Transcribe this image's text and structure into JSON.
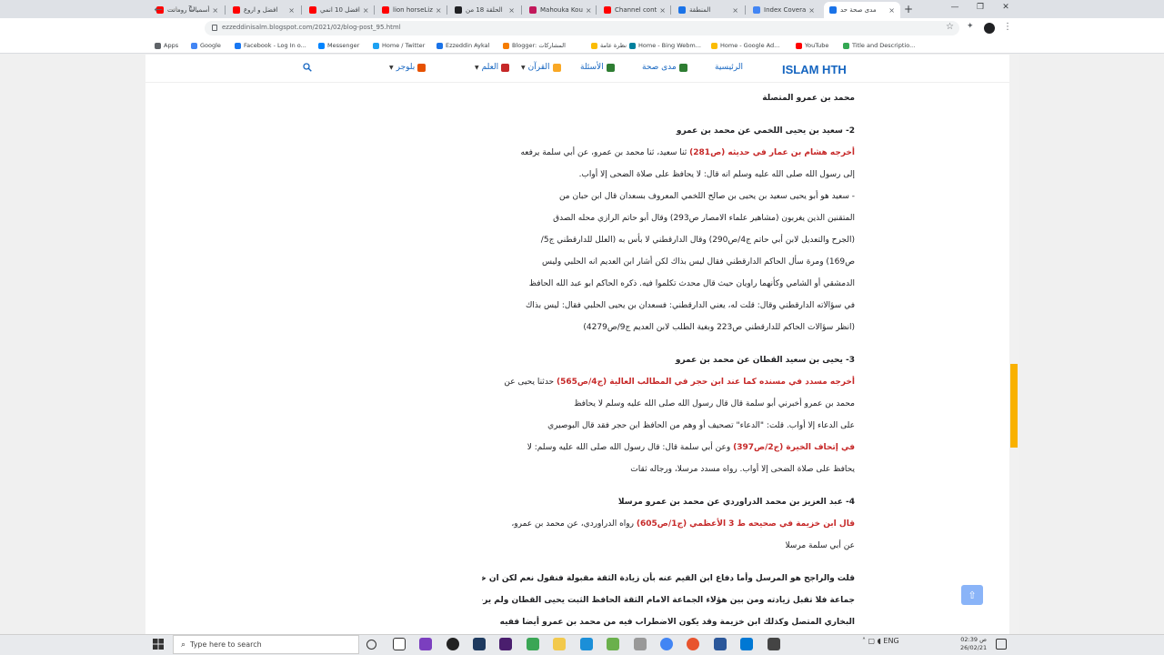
{
  "browser": {
    "tabs": [
      {
        "label": "أسميات رومانت",
        "color": "#ff0000"
      },
      {
        "label": "افضل و اروع",
        "color": "#ff0000"
      },
      {
        "label": "افضل 10 انمي",
        "color": "#ff0000"
      },
      {
        "label": "lion horseLiz",
        "color": "#ff0000"
      },
      {
        "label": "الحلقة 18 من",
        "color": "#202124"
      },
      {
        "label": "Mahouka Kou",
        "color": "#c2185b"
      },
      {
        "label": "Channel cont",
        "color": "#ff0000"
      },
      {
        "label": "المنطقة",
        "color": "#1a73e8"
      },
      {
        "label": "Index Covera",
        "color": "#4285f4"
      },
      {
        "label": "مدى صحة حد",
        "color": "#1a73e8"
      }
    ],
    "new_tab": "+",
    "win_min": "—",
    "win_max": "❐",
    "win_close": "✕",
    "url": "ezzeddinisalm.blogspot.com/2021/02/blog-post_95.html",
    "bookmarks": [
      {
        "label": "Apps",
        "color": "#5f6368"
      },
      {
        "label": "Google",
        "color": "#4285f4"
      },
      {
        "label": "Facebook - Log In o...",
        "color": "#1877f2"
      },
      {
        "label": "Messenger",
        "color": "#0084ff"
      },
      {
        "label": "Home / Twitter",
        "color": "#1da1f2"
      },
      {
        "label": "Ezzeddin Aykal",
        "color": "#1a73e8"
      },
      {
        "label": "Blogger: المشاركات",
        "color": "#f57c00"
      },
      {
        "label": "نظرة عامة",
        "color": "#fbbc04"
      },
      {
        "label": "Home - Bing Webm...",
        "color": "#00809d"
      },
      {
        "label": "Home - Google Ad...",
        "color": "#fbbc04"
      },
      {
        "label": "YouTube",
        "color": "#ff0000"
      },
      {
        "label": "Title and Descriptio...",
        "color": "#34a853"
      }
    ]
  },
  "blog": {
    "title": "ISLAM HTH",
    "menu": [
      {
        "label": "الرئيسية",
        "color": "#1565c0",
        "has_caret": false
      },
      {
        "label": "مدى صحة",
        "color": "#2e7d32",
        "has_caret": false
      },
      {
        "label": "الأسئلة",
        "color": "#2e7d32",
        "has_caret": false
      },
      {
        "label": "القرآن",
        "color": "#f9a825",
        "has_caret": true
      },
      {
        "label": "العلم",
        "color": "#c62828",
        "has_caret": true
      },
      {
        "label": "بلوجر",
        "color": "#e65100",
        "has_caret": true
      }
    ]
  },
  "article": {
    "p0": [
      "محمد بن عمرو المتصلة"
    ],
    "h2": "2- سعيد بن يحيى اللخمي عن محمد بن عمرو",
    "p2": [
      {
        "red": "أخرجه هشام بن عمار في حديثه (ص281)",
        "rest": " ثنا سعيد، ثنا محمد بن عمرو، عن أبي سلمة يرفعه"
      },
      {
        "red": "",
        "rest": "إلى رسول الله صلى الله عليه وسلم انه قال: لا يحافظ على صلاة الضحى إلا أواب."
      },
      {
        "red": "",
        "rest": "- سعيد هو أبو يحيى سعيد بن يحيى بن صالح اللخمي المعروف بسعدان قال ابن حبان من"
      },
      {
        "red": "",
        "rest": "المتقنين الذين يغربون (مشاهير علماء الامصار ص293) وقال أبو حاتم الرازي محله الصدق"
      },
      {
        "red": "",
        "rest": "(الجرح والتعديل لابن أبي حاتم ج4/ص290) وقال الدارقطني لا بأس به (العلل للدارقطني ج5/"
      },
      {
        "red": "",
        "rest": "ص169) ومرة سأل الحاكم الدارقطني فقال ليس بذاك لكن أشار ابن العديم انه الحلبي وليس"
      },
      {
        "red": "",
        "rest": "الدمشقي أو الشامي وكأنهما راويان حيث قال محدث تكلموا فيه. ذكره الحاكم ابو عبد الله الحافظ"
      },
      {
        "red": "",
        "rest": "في سؤالاته الدارقطني وقال: قلت له، يعني الدارقطني: فسعدان بن يحيى الحلبي فقال: ليس بذاك"
      },
      {
        "red": "",
        "rest": "(انظر سؤالات الحاكم للدارقطني ص223 وبغية الطلب لابن العديم ج9/ص4279)"
      }
    ],
    "h3": "3- يحيى بن سعيد القطان عن محمد بن عمرو",
    "p3": [
      {
        "red": "أخرجه مسدد في مسنده كما عند ابن حجر في المطالب العالية (ج4/ص565)",
        "rest": " حدثنا يحيى عن"
      },
      {
        "red": "",
        "rest": "محمد بن عمرو أخبرني أبو سلمة قال قال رسول الله صلى الله عليه وسلم لا يحافظ"
      },
      {
        "red": "",
        "rest": "على الدعاء إلا أواب. قلت: \"الدعاء\" تصحيف أو وهم من الحافظ ابن حجر فقد قال البوصيري"
      },
      {
        "red": "في إتحاف الخيرة (ج2/ص397)",
        "rest": " وعن أبي سلمة قال: قال رسول الله صلى الله عليه وسلم: لا"
      },
      {
        "red": "",
        "rest": "يحافظ على صلاة الضحى إلا أواب. رواه مسدد مرسلا، ورجاله ثقات"
      }
    ],
    "h4": "4- عبد العزيز بن محمد الدراوردي عن محمد بن عمرو مرسلا",
    "p4": [
      {
        "red": "قال ابن خزيمة في صحيحه ط 3 الأعظمي (ج1/ص605)",
        "rest": " رواه الدراوردي، عن محمد بن عمرو،"
      },
      {
        "red": "",
        "rest": "عن أبي سلمة مرسلا"
      }
    ],
    "p5": [
      "قلت والراجح هو المرسل وأما دفاع ابن القيم عنه بأن زيادة الثقة مقبولة فنقول نعم لكن ان خالفه",
      "جماعة فلا تقبل زيادته ومن بين هؤلاء الجماعة الامام الثقة الحافظ الثبت يحيى القطان ولم يرجح",
      "البخاري المتصل وكذلك ابن خزيمة وقد يكون الاضطراب فيه من محمد بن عمرو أيضا ففيه"
    ]
  },
  "scroll_position": 0.62,
  "taskbar": {
    "search_placeholder": "Type here to search",
    "tray": "ENG",
    "time": "02:39 ص",
    "date": "26/02/21"
  }
}
